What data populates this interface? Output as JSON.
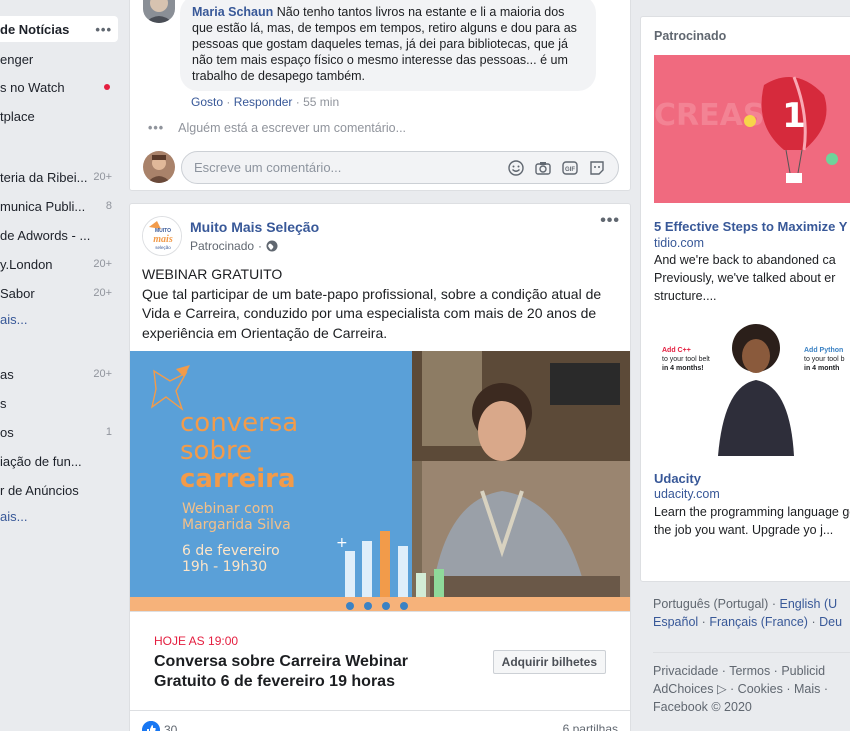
{
  "sidebar": {
    "items": [
      {
        "label": "de Notícias",
        "count": "",
        "active": true
      },
      {
        "label": "enger",
        "count": ""
      },
      {
        "label": "s no Watch",
        "count": "",
        "dot": true
      },
      {
        "label": "tplace",
        "count": ""
      },
      {
        "label": "teria da Ribei...",
        "count": "20+"
      },
      {
        "label": "munica Publi...",
        "count": "8"
      },
      {
        "label": " de Adwords - ...",
        "count": ""
      },
      {
        "label": "y.London",
        "count": "20+"
      },
      {
        "label": " Sabor",
        "count": "20+"
      },
      {
        "label": "ais...",
        "count": "",
        "more": true
      },
      {
        "label": "as",
        "count": "20+"
      },
      {
        "label": "s",
        "count": ""
      },
      {
        "label": "os",
        "count": "1"
      },
      {
        "label": "iação de fun...",
        "count": ""
      },
      {
        "label": "r de Anúncios",
        "count": ""
      },
      {
        "label": "ais...",
        "count": "",
        "more": true
      }
    ],
    "more_dots": "•••"
  },
  "comment": {
    "author": "Maria Schaun",
    "text": "Não tenho tantos livros na estante e li a maioria dos que estão lá, mas, de tempos em tempos, retiro alguns e dou para as pessoas que gostam daqueles temas, já dei para bibliotecas, que já não tem mais espaço físico o mesmo interesse das pessoas... é um trabalho de desapego também.",
    "like": "Gosto",
    "reply": "Responder",
    "time": "55 min",
    "sep": "·",
    "typing": "Alguém está a escrever um comentário...",
    "input_placeholder": "Escreve um comentário..."
  },
  "post": {
    "page_name": "Muito Mais Seleção",
    "sponsored": "Patrocinado",
    "more": "•••",
    "text_lines": [
      "WEBINAR GRATUITO",
      "Que tal participar de um bate-papo profissional, sobre a condição atual de Vida e Carreira, conduzido por uma especialista com mais de 20 anos de experiência em Orientação de Carreira."
    ],
    "image": {
      "line1": "conversa",
      "line2": "sobre",
      "line3": "carreira",
      "line4": "Webinar com",
      "line5": "Margarida Silva",
      "line6": "6 de fevereiro",
      "line7": "19h - 19h30"
    },
    "logo": {
      "top": "MUITO",
      "mid": "mais",
      "bottom": "seleção"
    },
    "event": {
      "date": "HOJE AS 19:00",
      "title": "Conversa sobre Carreira Webinar Gratuito 6 de fevereiro 19 horas",
      "button": "Adquirir bilhetes"
    },
    "reactions_count": "30",
    "shares": "6 partilhas"
  },
  "sponsored": {
    "header": "Patrocinado",
    "ads": [
      {
        "title": "5 Effective Steps to Maximize Y",
        "domain": "tidio.com",
        "desc": "And we're back to abandoned ca Previously, we've talked about er structure....",
        "image_text": "CREASE"
      },
      {
        "title": "Udacity",
        "domain": "udacity.com",
        "desc": "Learn the programming language get the job you want. Upgrade yo j...",
        "card1": {
          "l1": "Add C++",
          "l2": "to your tool belt",
          "l3": "in 4 months!"
        },
        "card2": {
          "l1": "Add Python",
          "l2": "to your tool b",
          "l3": "in 4 month"
        }
      }
    ]
  },
  "languages": {
    "current": "Português (Portugal)",
    "sep": "·",
    "others": [
      "English (U",
      "Español",
      "Français (France)",
      "Deu"
    ]
  },
  "footer": {
    "links": [
      "Privacidade",
      "Termos",
      "Publicid",
      "AdChoices",
      "Cookies",
      "Mais"
    ],
    "copyright": "Facebook © 2020"
  },
  "colors": {
    "link": "#385898",
    "blue_bg": "#5aa0d8",
    "orange": "#f29b4a",
    "ad_pink": "#f06a7f"
  }
}
